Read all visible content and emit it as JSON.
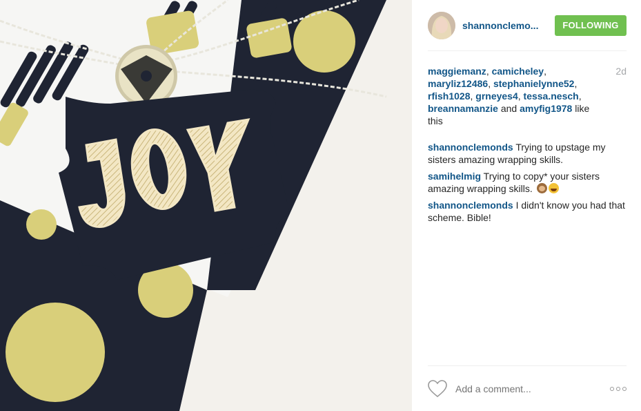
{
  "post": {
    "username": "shannonclemo...",
    "follow_label": "FOLLOWING",
    "time_ago": "2d",
    "photo_alt_text": "JOY"
  },
  "likes": {
    "users": [
      "maggiemanz",
      "camicheley",
      "maryliz12486",
      "stephanielynne52",
      "rfish1028",
      "grneyes4",
      "tessa.nesch",
      "breannamanzie",
      "amyfig1978"
    ],
    "sep": ", ",
    "and": " and ",
    "suffix": " like this"
  },
  "comments": [
    {
      "user": "shannonclemonds",
      "text": " Trying to upstage my sisters amazing wrapping skills."
    },
    {
      "user": "samihelmig",
      "text": " Trying to copy* your sisters amazing wrapping skills. ",
      "emojis": [
        "monkey",
        "laugh"
      ]
    },
    {
      "user": "shannonclemonds",
      "text": " I didn't know you had that scheme. Bible!"
    }
  ],
  "footer": {
    "comment_placeholder": "Add a comment...",
    "heart_icon": "heart-icon",
    "more_icon": "more-options-icon"
  },
  "colors": {
    "link": "#125688",
    "follow_bg": "#70c050",
    "navy": "#1f2433",
    "gold": "#d9cf7a"
  }
}
